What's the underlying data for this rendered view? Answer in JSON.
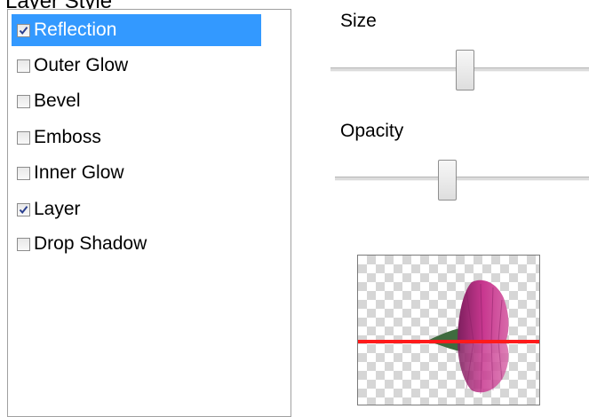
{
  "window": {
    "title": "Layer Style"
  },
  "effects": {
    "items": [
      {
        "label": "Reflection",
        "checked": true,
        "selected": true
      },
      {
        "label": "Outer Glow",
        "checked": false,
        "selected": false
      },
      {
        "label": "Bevel",
        "checked": false,
        "selected": false
      },
      {
        "label": "Emboss",
        "checked": false,
        "selected": false
      },
      {
        "label": "Inner Glow",
        "checked": false,
        "selected": false
      },
      {
        "label": "Layer",
        "checked": true,
        "selected": false
      },
      {
        "label": "Drop Shadow",
        "checked": false,
        "selected": false
      }
    ]
  },
  "controls": {
    "size_label": "Size",
    "size_value_fraction": 0.52,
    "opacity_label": "Opacity",
    "opacity_value_fraction": 0.44
  },
  "preview": {
    "reflection_line_color": "#ff1a1a",
    "flower_color": "#c8378f"
  },
  "colors": {
    "selection": "#3399ff",
    "checkmark": "#2a3f8f"
  }
}
